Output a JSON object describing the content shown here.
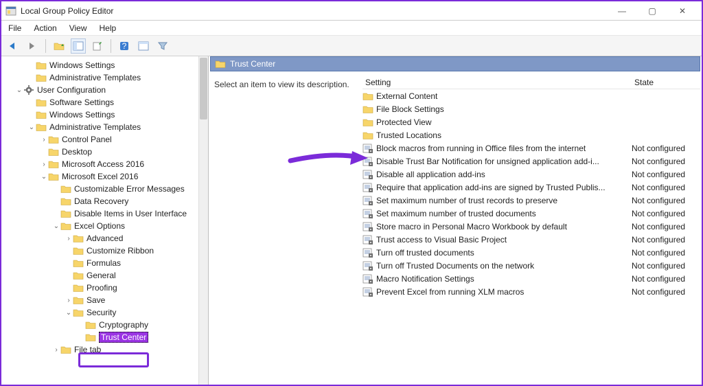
{
  "window": {
    "title": "Local Group Policy Editor"
  },
  "menu": [
    "File",
    "Action",
    "View",
    "Help"
  ],
  "tree": [
    {
      "d": 2,
      "tw": "",
      "icon": "folder",
      "label": "Windows Settings"
    },
    {
      "d": 2,
      "tw": "",
      "icon": "folder",
      "label": "Administrative Templates"
    },
    {
      "d": 1,
      "tw": "v",
      "icon": "gear",
      "label": "User Configuration"
    },
    {
      "d": 2,
      "tw": "",
      "icon": "folder",
      "label": "Software Settings"
    },
    {
      "d": 2,
      "tw": "",
      "icon": "folder",
      "label": "Windows Settings"
    },
    {
      "d": 2,
      "tw": "v",
      "icon": "folder",
      "label": "Administrative Templates"
    },
    {
      "d": 3,
      "tw": ">",
      "icon": "folder",
      "label": "Control Panel"
    },
    {
      "d": 3,
      "tw": "",
      "icon": "folder",
      "label": "Desktop"
    },
    {
      "d": 3,
      "tw": ">",
      "icon": "folder",
      "label": "Microsoft Access 2016"
    },
    {
      "d": 3,
      "tw": "v",
      "icon": "folder",
      "label": "Microsoft Excel 2016"
    },
    {
      "d": 4,
      "tw": "",
      "icon": "folder",
      "label": "Customizable Error Messages"
    },
    {
      "d": 4,
      "tw": "",
      "icon": "folder",
      "label": "Data Recovery"
    },
    {
      "d": 4,
      "tw": "",
      "icon": "folder",
      "label": "Disable Items in User Interface"
    },
    {
      "d": 4,
      "tw": "v",
      "icon": "folder",
      "label": "Excel Options"
    },
    {
      "d": 5,
      "tw": ">",
      "icon": "folder",
      "label": "Advanced"
    },
    {
      "d": 5,
      "tw": "",
      "icon": "folder",
      "label": "Customize Ribbon"
    },
    {
      "d": 5,
      "tw": "",
      "icon": "folder",
      "label": "Formulas"
    },
    {
      "d": 5,
      "tw": "",
      "icon": "folder",
      "label": "General"
    },
    {
      "d": 5,
      "tw": "",
      "icon": "folder",
      "label": "Proofing"
    },
    {
      "d": 5,
      "tw": ">",
      "icon": "folder",
      "label": "Save"
    },
    {
      "d": 5,
      "tw": "v",
      "icon": "folder",
      "label": "Security"
    },
    {
      "d": 6,
      "tw": "",
      "icon": "folder",
      "label": "Cryptography"
    },
    {
      "d": 6,
      "tw": "",
      "icon": "folder",
      "label": "Trust Center",
      "sel": true
    },
    {
      "d": 4,
      "tw": ">",
      "icon": "folder",
      "label": "File tab"
    }
  ],
  "header": "Trust Center",
  "desc": "Select an item to view its description.",
  "cols": {
    "setting": "Setting",
    "state": "State"
  },
  "rows": [
    {
      "icon": "folder",
      "txt": "External Content",
      "state": ""
    },
    {
      "icon": "folder",
      "txt": "File Block Settings",
      "state": ""
    },
    {
      "icon": "folder",
      "txt": "Protected View",
      "state": ""
    },
    {
      "icon": "folder",
      "txt": "Trusted Locations",
      "state": ""
    },
    {
      "icon": "policy",
      "txt": "Block macros from running in Office files from the internet",
      "state": "Not configured"
    },
    {
      "icon": "policy",
      "txt": "Disable Trust Bar Notification for unsigned application add-i...",
      "state": "Not configured"
    },
    {
      "icon": "policy",
      "txt": "Disable all application add-ins",
      "state": "Not configured"
    },
    {
      "icon": "policy",
      "txt": "Require that application add-ins are signed by Trusted Publis...",
      "state": "Not configured"
    },
    {
      "icon": "policy",
      "txt": "Set maximum number of trust records to preserve",
      "state": "Not configured"
    },
    {
      "icon": "policy",
      "txt": "Set maximum number of trusted documents",
      "state": "Not configured"
    },
    {
      "icon": "policy",
      "txt": "Store macro in Personal Macro Workbook by default",
      "state": "Not configured"
    },
    {
      "icon": "policy",
      "txt": "Trust access to Visual Basic Project",
      "state": "Not configured"
    },
    {
      "icon": "policy",
      "txt": "Turn off trusted documents",
      "state": "Not configured"
    },
    {
      "icon": "policy",
      "txt": "Turn off Trusted Documents on the network",
      "state": "Not configured"
    },
    {
      "icon": "policy",
      "txt": "Macro Notification Settings",
      "state": "Not configured"
    },
    {
      "icon": "policy",
      "txt": "Prevent Excel from running XLM macros",
      "state": "Not configured"
    }
  ]
}
